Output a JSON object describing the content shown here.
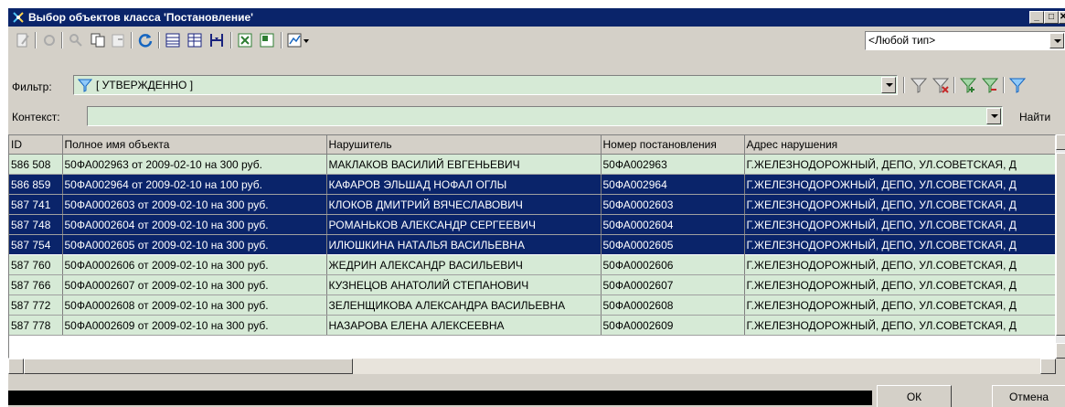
{
  "window": {
    "title": "Выбор объектов класса 'Постановление'",
    "controls": {
      "minimize": "_",
      "maximize": "□",
      "close": "✕"
    }
  },
  "toolbar": {
    "type_select_value": "<Любой тип>"
  },
  "filter": {
    "label": "Фильтр:",
    "value": "[ УТВЕРЖДЕННО ]"
  },
  "context": {
    "label": "Контекст:",
    "value": "",
    "find_label": "Найти"
  },
  "table": {
    "columns": [
      "ID",
      "Полное имя объекта",
      "Нарушитель",
      "Номер постановления",
      "Адрес нарушения"
    ],
    "rows": [
      {
        "id": "586 508",
        "name": "50ФА002963 от 2009-02-10 на 300 руб.",
        "violator": "МАКЛАКОВ ВАСИЛИЙ ЕВГЕНЬЕВИЧ",
        "number": "50ФА002963",
        "address": "Г.ЖЕЛЕЗНОДОРОЖНЫЙ, ДЕПО, УЛ.СОВЕТСКАЯ, Д"
      },
      {
        "id": "586 859",
        "name": "50ФА002964 от 2009-02-10 на 100 руб.",
        "violator": "КАФАРОВ ЭЛЬШАД НОФАЛ ОГЛЫ",
        "number": "50ФА002964",
        "address": "Г.ЖЕЛЕЗНОДОРОЖНЫЙ, ДЕПО, УЛ.СОВЕТСКАЯ, Д"
      },
      {
        "id": "587 741",
        "name": "50ФА0002603 от 2009-02-10 на 300 руб.",
        "violator": "КЛОКОВ ДМИТРИЙ ВЯЧЕСЛАВОВИЧ",
        "number": "50ФА0002603",
        "address": "Г.ЖЕЛЕЗНОДОРОЖНЫЙ, ДЕПО, УЛ.СОВЕТСКАЯ, Д"
      },
      {
        "id": "587 748",
        "name": "50ФА0002604 от 2009-02-10 на 300 руб.",
        "violator": "РОМАНЬКОВ АЛЕКСАНДР СЕРГЕЕВИЧ",
        "number": "50ФА0002604",
        "address": "Г.ЖЕЛЕЗНОДОРОЖНЫЙ, ДЕПО, УЛ.СОВЕТСКАЯ, Д"
      },
      {
        "id": "587 754",
        "name": "50ФА0002605 от 2009-02-10 на 300 руб.",
        "violator": "ИЛЮШКИНА НАТАЛЬЯ ВАСИЛЬЕВНА",
        "number": "50ФА0002605",
        "address": "Г.ЖЕЛЕЗНОДОРОЖНЫЙ, ДЕПО, УЛ.СОВЕТСКАЯ, Д"
      },
      {
        "id": "587 760",
        "name": "50ФА0002606 от 2009-02-10 на 300 руб.",
        "violator": "ЖЕДРИН АЛЕКСАНДР ВАСИЛЬЕВИЧ",
        "number": "50ФА0002606",
        "address": "Г.ЖЕЛЕЗНОДОРОЖНЫЙ, ДЕПО, УЛ.СОВЕТСКАЯ, Д"
      },
      {
        "id": "587 766",
        "name": "50ФА0002607 от 2009-02-10 на 300 руб.",
        "violator": "КУЗНЕЦОВ АНАТОЛИЙ СТЕПАНОВИЧ",
        "number": "50ФА0002607",
        "address": "Г.ЖЕЛЕЗНОДОРОЖНЫЙ, ДЕПО, УЛ.СОВЕТСКАЯ, Д"
      },
      {
        "id": "587 772",
        "name": "50ФА0002608 от 2009-02-10 на 300 руб.",
        "violator": "ЗЕЛЕНЩИКОВА АЛЕКСАНДРА ВАСИЛЬЕВНА",
        "number": "50ФА0002608",
        "address": "Г.ЖЕЛЕЗНОДОРОЖНЫЙ, ДЕПО, УЛ.СОВЕТСКАЯ, Д"
      },
      {
        "id": "587 778",
        "name": "50ФА0002609 от 2009-02-10 на 300 руб.",
        "violator": "НАЗАРОВА ЕЛЕНА АЛЕКСЕЕВНА",
        "number": "50ФА0002609",
        "address": "Г.ЖЕЛЕЗНОДОРОЖНЫЙ, ДЕПО, УЛ.СОВЕТСКАЯ, Д"
      }
    ],
    "selected_rows": [
      1,
      2,
      3,
      4
    ]
  },
  "buttons": {
    "ok": "ОК",
    "cancel": "Отмена"
  },
  "colors": {
    "titlebar": "#0a246a",
    "row_normal": "#d6ead6",
    "row_selected": "#0a246a",
    "filter_field": "#d6ead6",
    "status_bar": "#000000"
  },
  "icons": [
    "edit-icon",
    "properties-icon",
    "key-icon",
    "copy-icon",
    "paste-icon",
    "refresh-icon",
    "columns-icon",
    "table-icon",
    "tree-icon",
    "excel-export-icon",
    "excel-icon",
    "report-icon",
    "chart-icon",
    "filter-icon",
    "filter-clear-icon",
    "filter-add-icon",
    "filter-remove-icon",
    "filter-settings-icon"
  ]
}
